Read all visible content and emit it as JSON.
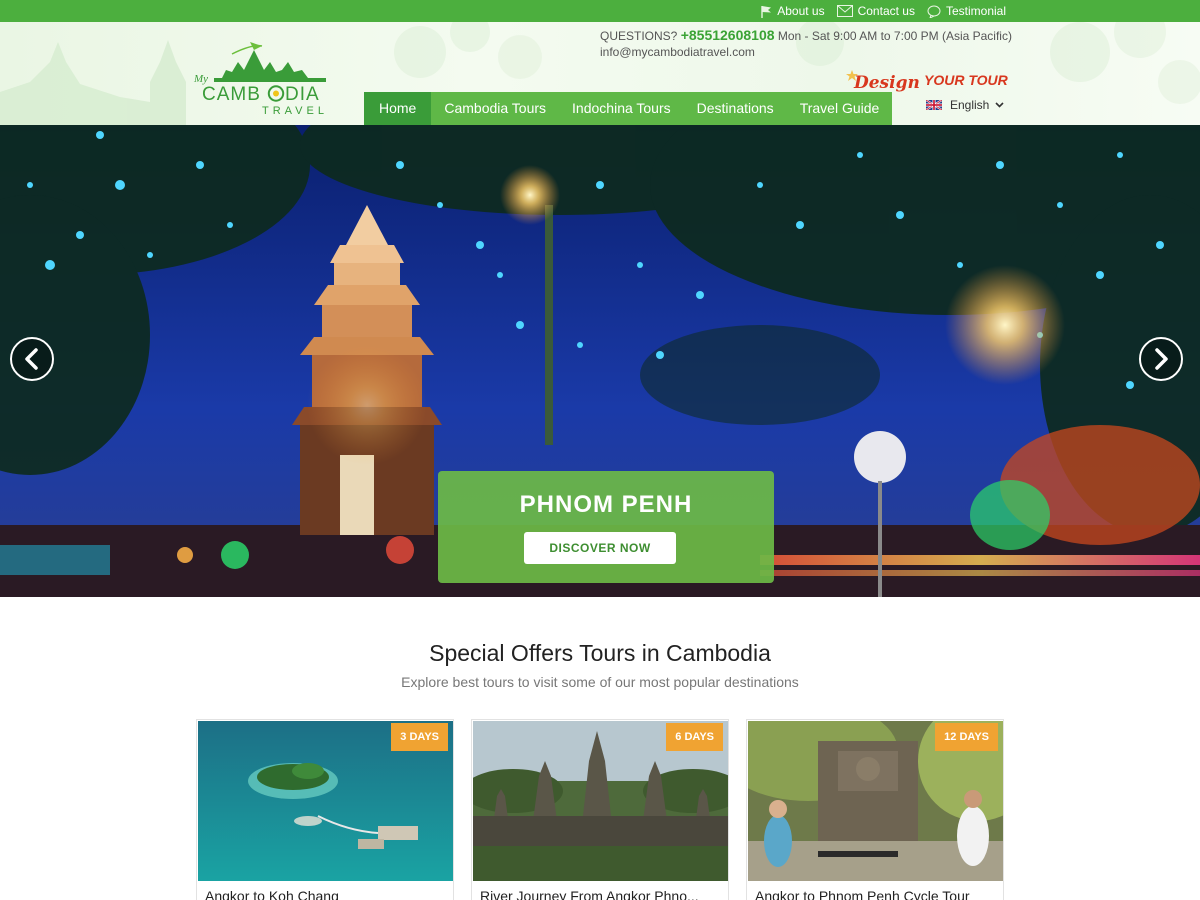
{
  "topbar": {
    "links": [
      {
        "label": "About us",
        "icon": "flag-icon"
      },
      {
        "label": "Contact us",
        "icon": "envelope-icon"
      },
      {
        "label": "Testimonial",
        "icon": "speech-bubble-icon"
      }
    ]
  },
  "header": {
    "logo": {
      "prefix": "My",
      "word1": "CAMB",
      "word1b": "DIA",
      "word2": "TRAVEL"
    },
    "contact": {
      "questions_label": "QUESTIONS?",
      "phone": "+85512608108",
      "hours": "Mon - Sat 9:00 AM to 7:00 PM (Asia Pacific)",
      "email": "info@mycambodiatravel.com"
    },
    "design_tour": {
      "word1": "Design",
      "word2": "YOUR TOUR"
    },
    "nav": [
      {
        "label": "Home",
        "active": true
      },
      {
        "label": "Cambodia Tours",
        "active": false
      },
      {
        "label": "Indochina Tours",
        "active": false
      },
      {
        "label": "Destinations",
        "active": false
      },
      {
        "label": "Travel Guide",
        "active": false
      }
    ],
    "language": {
      "label": "English",
      "icon": "uk-flag-icon"
    }
  },
  "hero": {
    "title": "PHNOM PENH",
    "button": "DISCOVER NOW",
    "prev_icon": "chevron-left-icon",
    "next_icon": "chevron-right-icon"
  },
  "offers": {
    "title": "Special Offers Tours in Cambodia",
    "subtitle": "Explore best tours to visit some of our most popular destinations",
    "tours": [
      {
        "days": "3 DAYS",
        "title": "Angkor to Koh Chang"
      },
      {
        "days": "6 DAYS",
        "title": "River Journey From Angkor Phno..."
      },
      {
        "days": "12 DAYS",
        "title": "Angkor to Phnom Penh Cycle Tour"
      }
    ]
  },
  "colors": {
    "brand_green": "#4caf3e",
    "nav_green": "#5fb847",
    "nav_active": "#3a9c39",
    "badge_orange": "#f0a332",
    "design_tour_red": "#d8371e"
  }
}
